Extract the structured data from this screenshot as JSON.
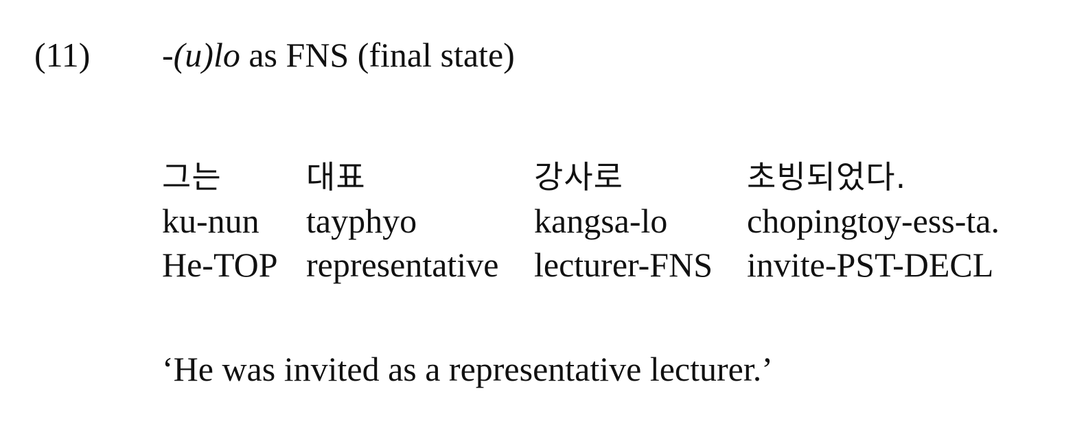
{
  "example": {
    "number": "(11)",
    "title_prefix": "-",
    "title_morpheme": "(u)lo",
    "title_rest": " as FNS (final state)"
  },
  "gloss": {
    "words": [
      {
        "hangul": "그는",
        "romanization": "ku-nun",
        "gloss": "He-TOP"
      },
      {
        "hangul": "대표",
        "romanization": "tayphyo",
        "gloss": "representative"
      },
      {
        "hangul": "강사로",
        "romanization": "kangsa-lo",
        "gloss": "lecturer-FNS"
      },
      {
        "hangul": "초빙되었다.",
        "romanization": "chopingtoy-ess-ta.",
        "gloss": "invite-PST-DECL"
      }
    ]
  },
  "translation": "‘He was invited as a representative lecturer.’"
}
